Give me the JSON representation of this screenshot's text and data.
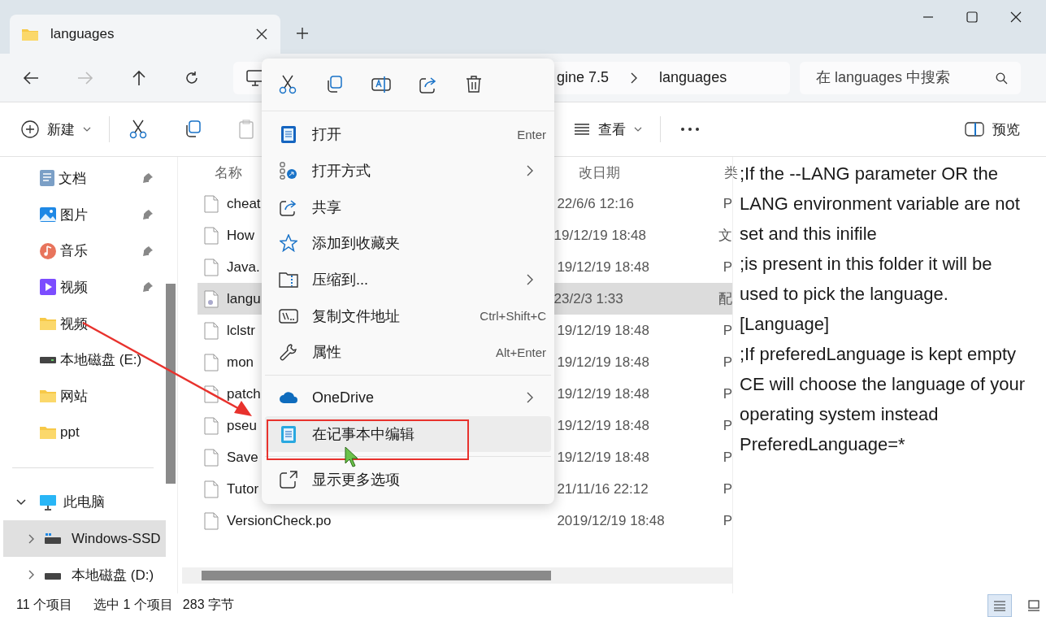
{
  "window": {
    "tab": {
      "title": "languages"
    }
  },
  "address": {
    "segments": [
      "gine 7.5",
      "languages"
    ]
  },
  "search": {
    "placeholder": "在 languages 中搜索"
  },
  "commands": {
    "new": "新建",
    "view": "查看",
    "preview": "预览"
  },
  "sidebar": {
    "quick": [
      {
        "label": "文档",
        "pinned": true
      },
      {
        "label": "图片",
        "pinned": true
      },
      {
        "label": "音乐",
        "pinned": true
      },
      {
        "label": "视频",
        "pinned": true
      },
      {
        "label": "视频",
        "pinned": false
      },
      {
        "label": "本地磁盘 (E:)",
        "pinned": false
      },
      {
        "label": "网站",
        "pinned": false
      },
      {
        "label": "ppt",
        "pinned": false
      }
    ],
    "this_pc": {
      "label": "此电脑",
      "expanded": true,
      "children": [
        {
          "label": "Windows-SSD",
          "selected": true,
          "expanded": false
        },
        {
          "label": "本地磁盘 (D:)",
          "selected": false,
          "expanded": false
        }
      ]
    }
  },
  "file_list": {
    "columns": [
      "名称",
      "改日期",
      "类"
    ],
    "rows": [
      {
        "name": "cheat",
        "date": "22/6/6 12:16",
        "type": "P",
        "selected": false
      },
      {
        "name": "How",
        "date": "19/12/19 18:48",
        "type": "文",
        "selected": false
      },
      {
        "name": "Java.",
        "date": "19/12/19 18:48",
        "type": "P",
        "selected": false
      },
      {
        "name": "langu",
        "date": "23/2/3 1:33",
        "type": "配",
        "selected": true
      },
      {
        "name": "lclstr",
        "date": "19/12/19 18:48",
        "type": "P",
        "selected": false
      },
      {
        "name": "mon",
        "date": "19/12/19 18:48",
        "type": "P",
        "selected": false
      },
      {
        "name": "patch",
        "date": "19/12/19 18:48",
        "type": "P",
        "selected": false
      },
      {
        "name": "pseu",
        "date": "19/12/19 18:48",
        "type": "P",
        "selected": false
      },
      {
        "name": "Save",
        "date": "19/12/19 18:48",
        "type": "P",
        "selected": false
      },
      {
        "name": "Tutor",
        "date": "21/11/16 22:12",
        "type": "P",
        "selected": false
      },
      {
        "name": "VersionCheck.po",
        "date": "2019/12/19 18:48",
        "type": "P",
        "selected": false
      }
    ]
  },
  "context_menu": {
    "items": [
      {
        "kind": "item",
        "label": "打开",
        "shortcut": "Enter",
        "submenu": false,
        "hovered": false
      },
      {
        "kind": "item",
        "label": "打开方式",
        "submenu": true,
        "hovered": false
      },
      {
        "kind": "item",
        "label": "共享",
        "submenu": false,
        "hovered": false
      },
      {
        "kind": "item",
        "label": "添加到收藏夹",
        "submenu": false,
        "hovered": false
      },
      {
        "kind": "item",
        "label": "压缩到...",
        "submenu": true,
        "hovered": false
      },
      {
        "kind": "item",
        "label": "复制文件地址",
        "shortcut": "Ctrl+Shift+C",
        "submenu": false,
        "hovered": false
      },
      {
        "kind": "item",
        "label": "属性",
        "shortcut": "Alt+Enter",
        "submenu": false,
        "hovered": false
      },
      {
        "kind": "divider"
      },
      {
        "kind": "item",
        "label": "OneDrive",
        "submenu": true,
        "hovered": false
      },
      {
        "kind": "item",
        "label": "在记事本中编辑",
        "submenu": false,
        "hovered": true
      },
      {
        "kind": "divider"
      },
      {
        "kind": "item",
        "label": "显示更多选项",
        "submenu": false,
        "hovered": false
      }
    ]
  },
  "preview": {
    "lines": [
      ";If the --LANG parameter OR the LANG environment variable are not set and this inifile",
      ";is present in this folder it will be used to pick the language.",
      "[Language]",
      ";If preferedLanguage is kept empty CE will choose the language of your operating system instead",
      "PreferedLanguage=*"
    ]
  },
  "status_bar": {
    "count": "11 个项目",
    "selection": "选中 1 个项目",
    "size": "283 字节"
  },
  "view_buttons": [
    {
      "kind": "details",
      "selected": true
    },
    {
      "kind": "tiles",
      "selected": false
    }
  ]
}
